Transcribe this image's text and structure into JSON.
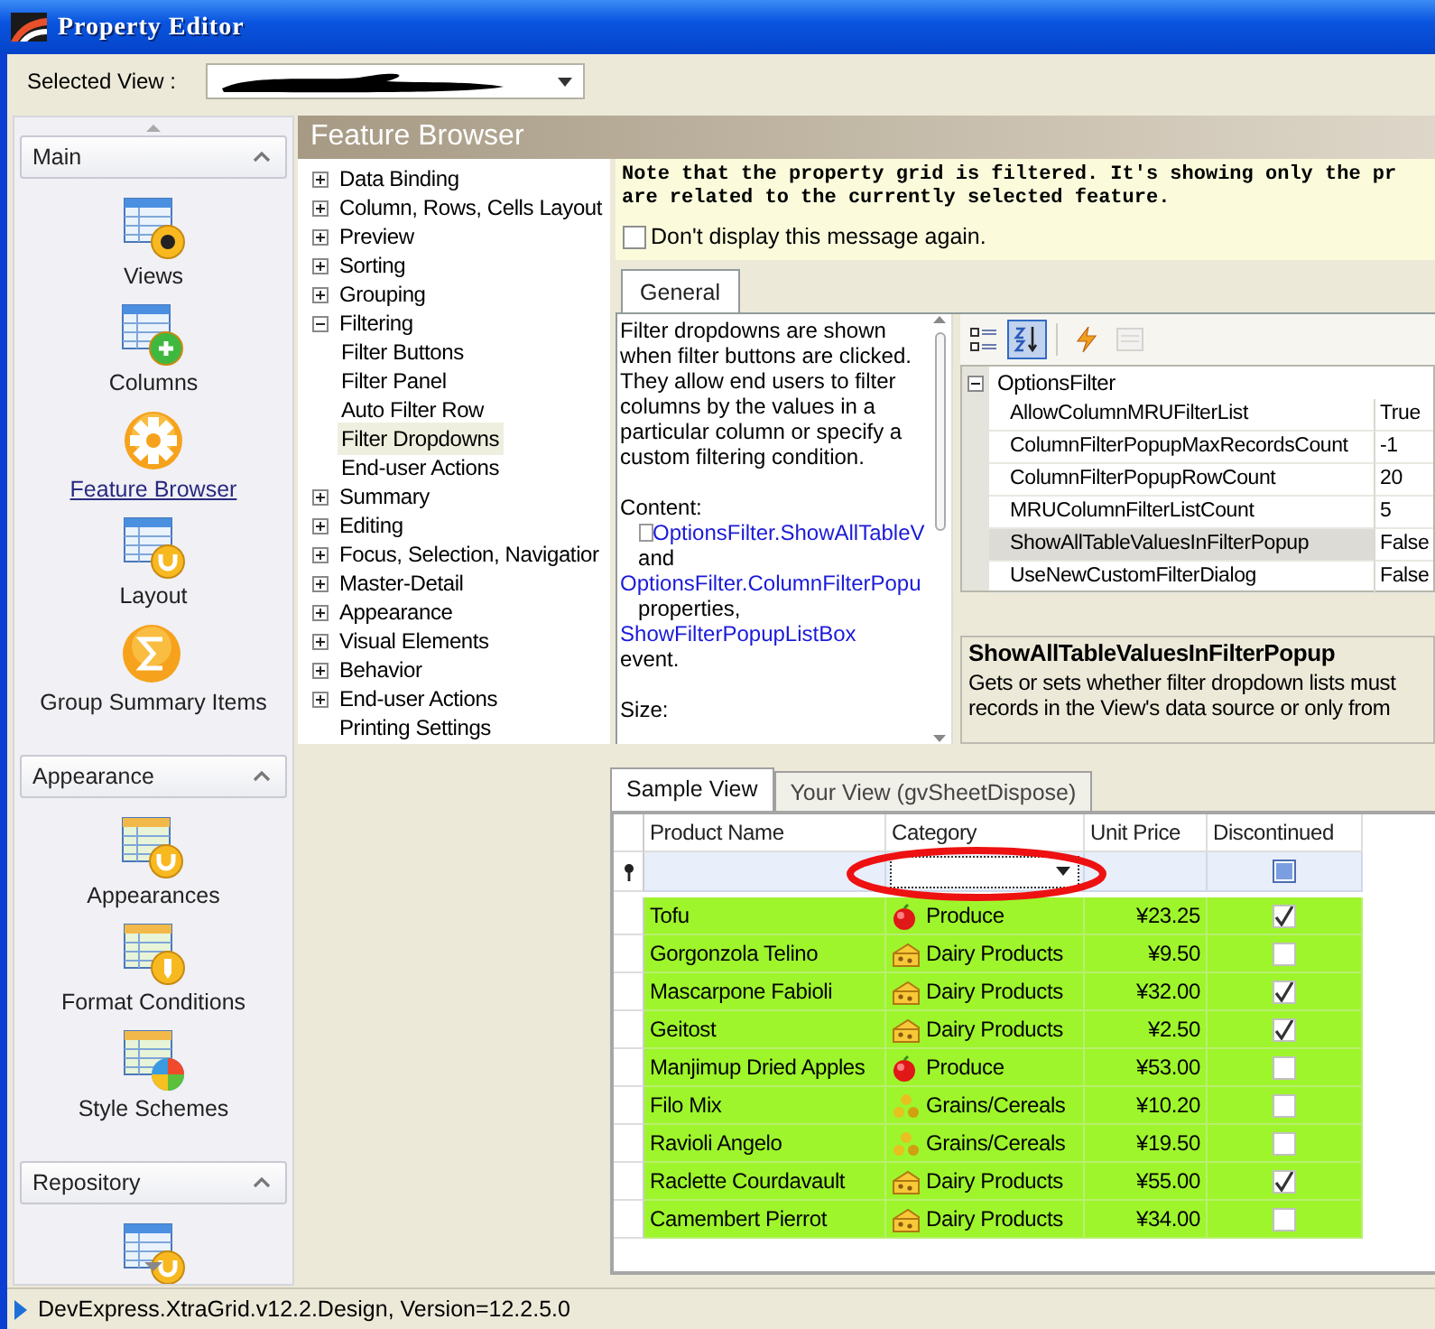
{
  "window": {
    "title": "Property Editor"
  },
  "selected_view": {
    "label": "Selected View :"
  },
  "nav_groups": [
    {
      "title": "Main",
      "expanded": true,
      "items": [
        {
          "label": "Views",
          "kind": "grid-eye",
          "selected": false
        },
        {
          "label": "Columns",
          "kind": "grid-plus",
          "selected": false
        },
        {
          "label": "Feature Browser",
          "kind": "gear",
          "selected": true
        },
        {
          "label": "Layout",
          "kind": "grid-wrench",
          "selected": false
        },
        {
          "label": "Group Summary Items",
          "kind": "sigma",
          "selected": false
        }
      ]
    },
    {
      "title": "Appearance",
      "expanded": true,
      "items": [
        {
          "label": "Appearances",
          "kind": "sheet-wrench",
          "selected": false
        },
        {
          "label": "Format Conditions",
          "kind": "sheet-pencil",
          "selected": false
        },
        {
          "label": "Style Schemes",
          "kind": "sheet-pie",
          "selected": false
        }
      ]
    },
    {
      "title": "Repository",
      "expanded": true,
      "items": [
        {
          "kind": "grid-wrench",
          "selected": false
        }
      ]
    }
  ],
  "header": {
    "title": "Feature Browser"
  },
  "tree": [
    {
      "label": "Data Binding",
      "expanded": false,
      "selected": false
    },
    {
      "label": "Column, Rows, Cells Layout",
      "expanded": false,
      "selected": false
    },
    {
      "label": "Preview",
      "expanded": false,
      "selected": false
    },
    {
      "label": "Sorting",
      "expanded": false,
      "selected": false
    },
    {
      "label": "Grouping",
      "expanded": false,
      "selected": false
    },
    {
      "label": "Filtering",
      "expanded": true,
      "selected": false,
      "children": [
        {
          "label": "Filter Buttons",
          "selected": false
        },
        {
          "label": "Filter Panel",
          "selected": false
        },
        {
          "label": "Auto Filter Row",
          "selected": false
        },
        {
          "label": "Filter Dropdowns",
          "selected": true
        },
        {
          "label": "End-user Actions",
          "selected": false
        }
      ]
    },
    {
      "label": "Summary",
      "expanded": false,
      "selected": false
    },
    {
      "label": "Editing",
      "expanded": false,
      "selected": false
    },
    {
      "label": "Focus, Selection, Navigatior",
      "expanded": false,
      "selected": false
    },
    {
      "label": "Master-Detail",
      "expanded": false,
      "selected": false
    },
    {
      "label": "Appearance",
      "expanded": false,
      "selected": false
    },
    {
      "label": "Visual Elements",
      "expanded": false,
      "selected": false
    },
    {
      "label": "Behavior",
      "expanded": false,
      "selected": false
    },
    {
      "label": "End-user Actions",
      "expanded": false,
      "selected": false
    },
    {
      "label": "Printing Settings",
      "selected": false
    }
  ],
  "note": {
    "lines": [
      "Note that the property grid is filtered. It's showing only the pr",
      "are related to the currently selected feature."
    ],
    "checkbox": {
      "label": "Don't display this message again.",
      "checked": false
    }
  },
  "page_tabs": [
    {
      "label": "General",
      "selected": true
    }
  ],
  "description": {
    "paragraph": "Filter dropdowns are shown when filter buttons are clicked. They allow end users to filter columns by the values in a particular column or specify a custom filtering condition.",
    "parts": [
      {
        "kind": "heading",
        "text": "Content:"
      },
      {
        "kind": "boxed-link",
        "text": "OptionsFilter.ShowAllTableV"
      },
      {
        "kind": "text",
        "text": "and"
      },
      {
        "kind": "link",
        "text": "OptionsFilter.ColumnFilterPopu"
      },
      {
        "kind": "text",
        "text": "properties,"
      },
      {
        "kind": "link",
        "text": "ShowFilterPopupListBox"
      },
      {
        "kind": "heading",
        "text": "event."
      },
      {
        "kind": "gap"
      },
      {
        "kind": "heading",
        "text": "Size:"
      }
    ]
  },
  "property_grid": {
    "toolbar": [
      {
        "kind": "categorized",
        "selected": false,
        "disabled": false
      },
      {
        "kind": "alphabetical",
        "selected": true,
        "disabled": false
      },
      {
        "kind": "events",
        "selected": false,
        "disabled": false
      },
      {
        "kind": "pages",
        "selected": false,
        "disabled": true
      }
    ],
    "category": {
      "label": "OptionsFilter",
      "expanded": true
    },
    "rows": [
      {
        "name": "AllowColumnMRUFilterList",
        "value": "True",
        "selected": false
      },
      {
        "name": "ColumnFilterPopupMaxRecordsCount",
        "value": "-1",
        "selected": false
      },
      {
        "name": "ColumnFilterPopupRowCount",
        "value": "20",
        "selected": false
      },
      {
        "name": "MRUColumnFilterListCount",
        "value": "5",
        "selected": false
      },
      {
        "name": "ShowAllTableValuesInFilterPopup",
        "value": "False",
        "selected": true
      },
      {
        "name": "UseNewCustomFilterDialog",
        "value": "False",
        "selected": false
      }
    ],
    "help": {
      "title": "ShowAllTableValuesInFilterPopup",
      "lines": [
        "Gets or sets whether filter dropdown lists must",
        "records in the View's data source or only from"
      ]
    }
  },
  "view_tabs": [
    {
      "label": "Sample View",
      "selected": true
    },
    {
      "label": "Your View (gvSheetDispose)",
      "selected": false
    }
  ],
  "grid": {
    "columns": [
      "Product Name",
      "Category",
      "Unit Price",
      "Discontinued"
    ],
    "filter_row": {
      "indeterminate": true
    },
    "rows": [
      {
        "product": "Tofu",
        "category": "Produce",
        "kind": "produce",
        "price": "¥23.25",
        "discontinued": true
      },
      {
        "product": "Gorgonzola Telino",
        "category": "Dairy Products",
        "kind": "dairy",
        "price": "¥9.50",
        "discontinued": false
      },
      {
        "product": "Mascarpone Fabioli",
        "category": "Dairy Products",
        "kind": "dairy",
        "price": "¥32.00",
        "discontinued": true
      },
      {
        "product": "Geitost",
        "category": "Dairy Products",
        "kind": "dairy",
        "price": "¥2.50",
        "discontinued": true
      },
      {
        "product": "Manjimup Dried Apples",
        "category": "Produce",
        "kind": "produce",
        "price": "¥53.00",
        "discontinued": false
      },
      {
        "product": "Filo Mix",
        "category": "Grains/Cereals",
        "kind": "grains",
        "price": "¥10.20",
        "discontinued": false
      },
      {
        "product": "Ravioli Angelo",
        "category": "Grains/Cereals",
        "kind": "grains",
        "price": "¥19.50",
        "discontinued": false
      },
      {
        "product": "Raclette Courdavault",
        "category": "Dairy Products",
        "kind": "dairy",
        "price": "¥55.00",
        "discontinued": true
      },
      {
        "product": "Camembert Pierrot",
        "category": "Dairy Products",
        "kind": "dairy",
        "price": "¥34.00",
        "discontinued": false
      }
    ]
  },
  "annotation": {
    "kind": "ellipse"
  },
  "status_bar": {
    "text": "DevExpress.XtraGrid.v12.2.Design, Version=12.2.5.0"
  }
}
